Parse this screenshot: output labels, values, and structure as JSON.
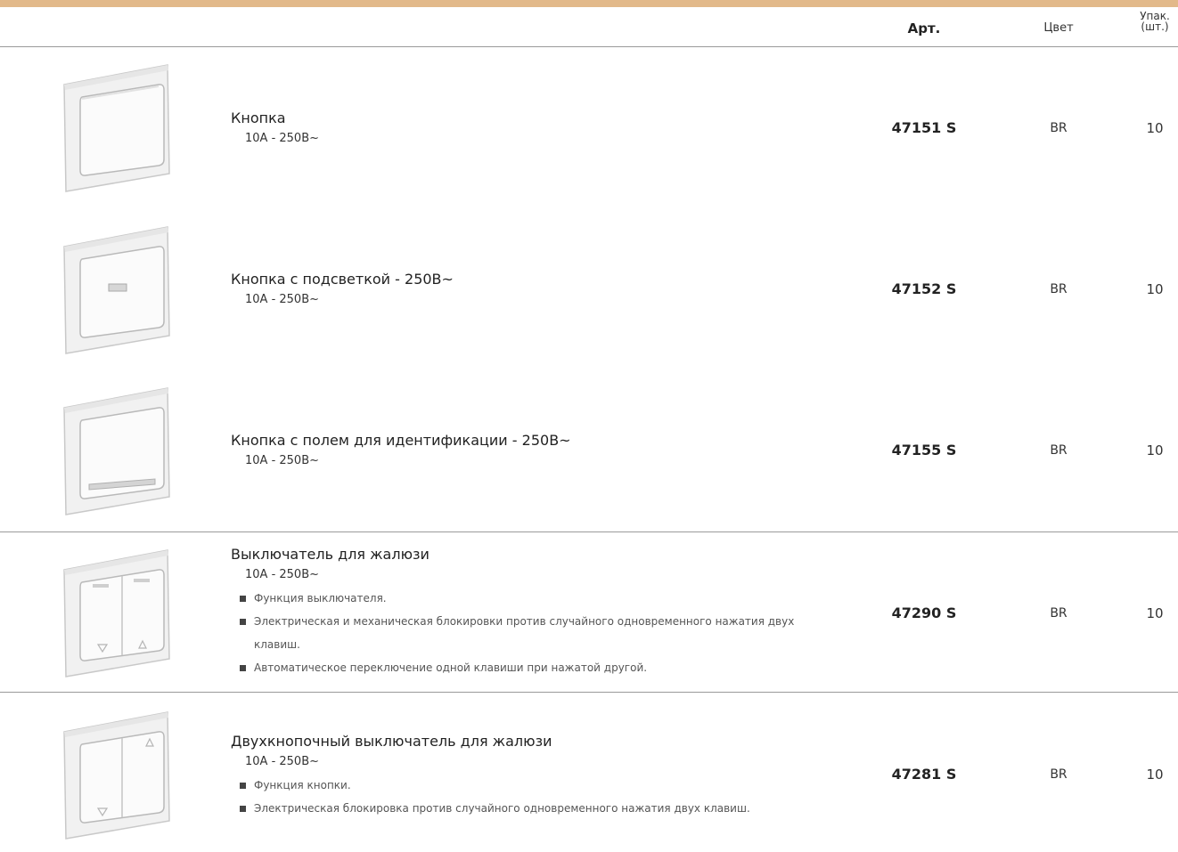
{
  "colors": {
    "accent_bar": "#e2b98a",
    "divider": "#9a9a9a"
  },
  "header": {
    "art": "Арт.",
    "color": "Цвет",
    "pack_line1": "Упак.",
    "pack_line2": "(шт.)"
  },
  "rows": [
    {
      "icon": "push-button-icon",
      "title": "Кнопка",
      "spec": "10А - 250В~",
      "bullets": [],
      "art": "47151 S",
      "color": "BR",
      "pack": "10"
    },
    {
      "icon": "illuminated-push-button-icon",
      "title": "Кнопка с подсветкой - 250В~",
      "spec": "10А - 250В~",
      "bullets": [],
      "art": "47152 S",
      "color": "BR",
      "pack": "10"
    },
    {
      "icon": "labelled-push-button-icon",
      "title": "Кнопка с полем для идентификации - 250В~",
      "spec": "10А - 250В~",
      "bullets": [],
      "art": "47155 S",
      "color": "BR",
      "pack": "10"
    },
    {
      "icon": "shutter-switch-icon",
      "title": "Выключатель для жалюзи",
      "spec": "10А - 250В~",
      "bullets": [
        "Функция выключателя.",
        "Электрическая и механическая блокировки против случайного одновременного нажатия двух",
        "клавиш.",
        "Автоматическое переключение одной клавиши при нажатой другой."
      ],
      "art": "47290 S",
      "color": "BR",
      "pack": "10"
    },
    {
      "icon": "double-shutter-button-icon",
      "title": "Двухкнопочный выключатель для жалюзи",
      "spec": "10А - 250В~",
      "bullets": [
        "Функция кнопки.",
        "Электрическая блокировка против случайного одновременного нажатия двух клавиш."
      ],
      "art": "47281 S",
      "color": "BR",
      "pack": "10"
    }
  ]
}
